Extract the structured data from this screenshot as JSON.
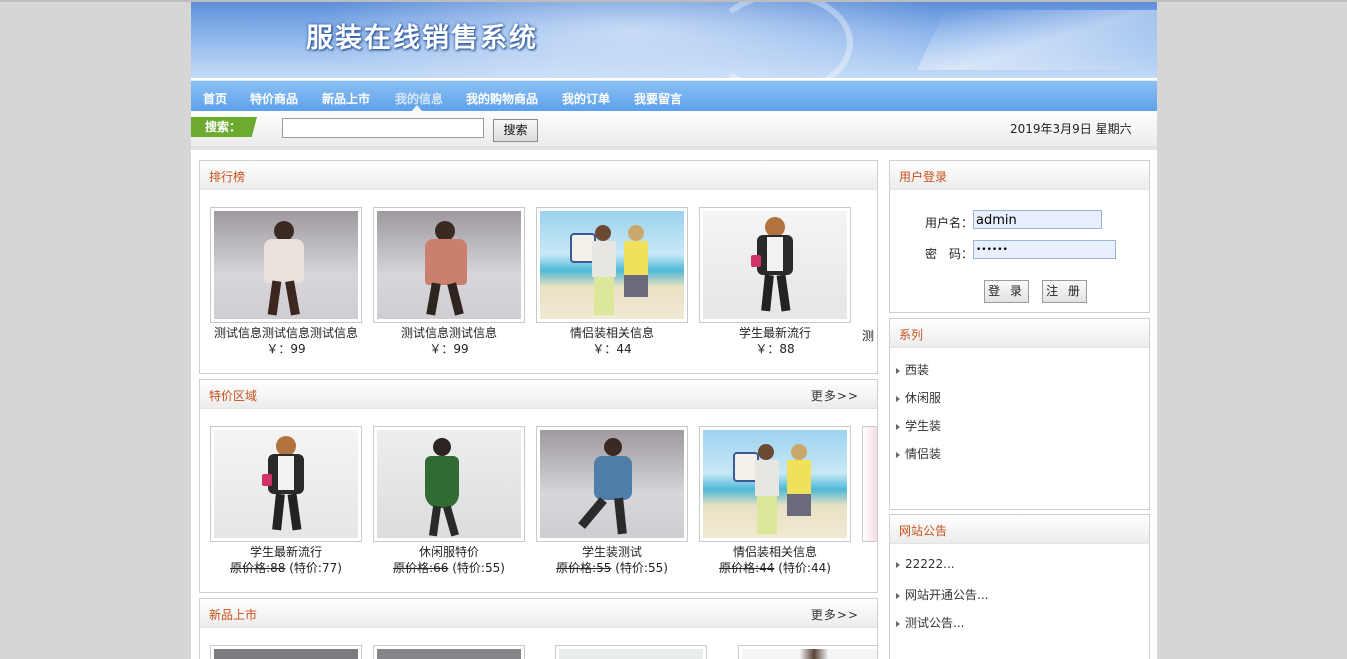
{
  "site": {
    "title": "服装在线销售系统"
  },
  "nav": {
    "items": [
      {
        "label": "首页"
      },
      {
        "label": "特价商品"
      },
      {
        "label": "新品上市"
      },
      {
        "label": "我的信息"
      },
      {
        "label": "我的购物商品"
      },
      {
        "label": "我的订单"
      },
      {
        "label": "我要留言"
      }
    ],
    "active": "我的信息"
  },
  "search": {
    "label": "搜索：",
    "value": "",
    "button": "搜索"
  },
  "date": "2019年3月9日 星期六",
  "ranking": {
    "title": "排行榜",
    "items": [
      {
        "name": "测试信息测试信息测试信息",
        "price": "￥：99",
        "image": "woman-white-coat-photo"
      },
      {
        "name": "测试信息测试信息",
        "price": "￥：99",
        "image": "woman-pink-coat-photo"
      },
      {
        "name": "情侣装相关信息",
        "price": "￥：44",
        "image": "couple-beach-photo"
      },
      {
        "name": "学生最新流行",
        "price": "￥：88",
        "image": "woman-black-cardigan-photo"
      }
    ],
    "partial": "测"
  },
  "special": {
    "title": "特价区域",
    "more": "更多>>",
    "items": [
      {
        "name": "学生最新流行",
        "orig_label": "原价格:",
        "orig": "88",
        "special": "(特价:77)",
        "image": "woman-black-cardigan-photo"
      },
      {
        "name": "休闲服特价",
        "orig_label": "原价格:",
        "orig": "66",
        "special": "(特价:55)",
        "image": "woman-green-dress-photo"
      },
      {
        "name": "学生装测试",
        "orig_label": "原价格:",
        "orig": "55",
        "special": "(特价:55)",
        "image": "woman-denim-photo"
      },
      {
        "name": "情侣装相关信息",
        "orig_label": "原价格:",
        "orig": "44",
        "special": "(特价:44)",
        "image": "couple-beach-photo"
      }
    ]
  },
  "new_arrivals": {
    "title": "新品上市",
    "more": "更多>>"
  },
  "login": {
    "title": "用户登录",
    "username_label": "用户名：",
    "username_value": "admin",
    "password_label": "密　码：",
    "password_value": "••••••",
    "login_button": "登 录",
    "register_button": "注 册"
  },
  "series": {
    "title": "系列",
    "items": [
      "西装",
      "休闲服",
      "学生装",
      "情侣装"
    ]
  },
  "notice": {
    "title": "网站公告",
    "items": [
      "22222...",
      "网站开通公告...",
      "测试公告..."
    ]
  }
}
